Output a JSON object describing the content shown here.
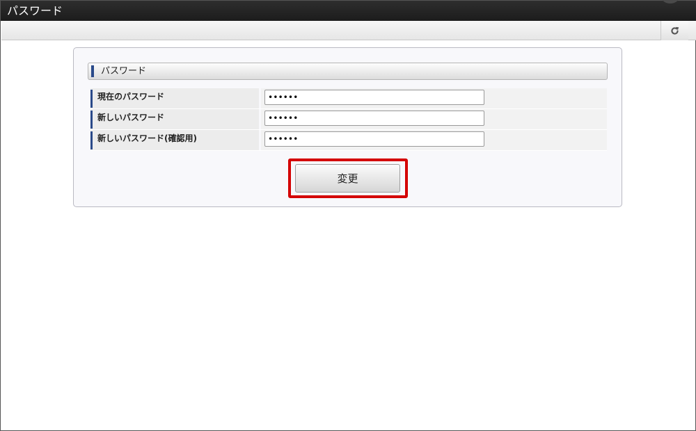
{
  "window": {
    "title": "パスワード"
  },
  "toolbar": {
    "refresh_icon": "refresh-icon"
  },
  "section": {
    "title": "パスワード"
  },
  "form": {
    "rows": [
      {
        "label": "現在のパスワード",
        "value": "••••••"
      },
      {
        "label": "新しいパスワード",
        "value": "••••••"
      },
      {
        "label": "新しいパスワード(確認用)",
        "value": "••••••"
      }
    ]
  },
  "actions": {
    "change_label": "変更"
  },
  "colors": {
    "accent": "#2a4a8a",
    "highlight": "#d40000"
  }
}
